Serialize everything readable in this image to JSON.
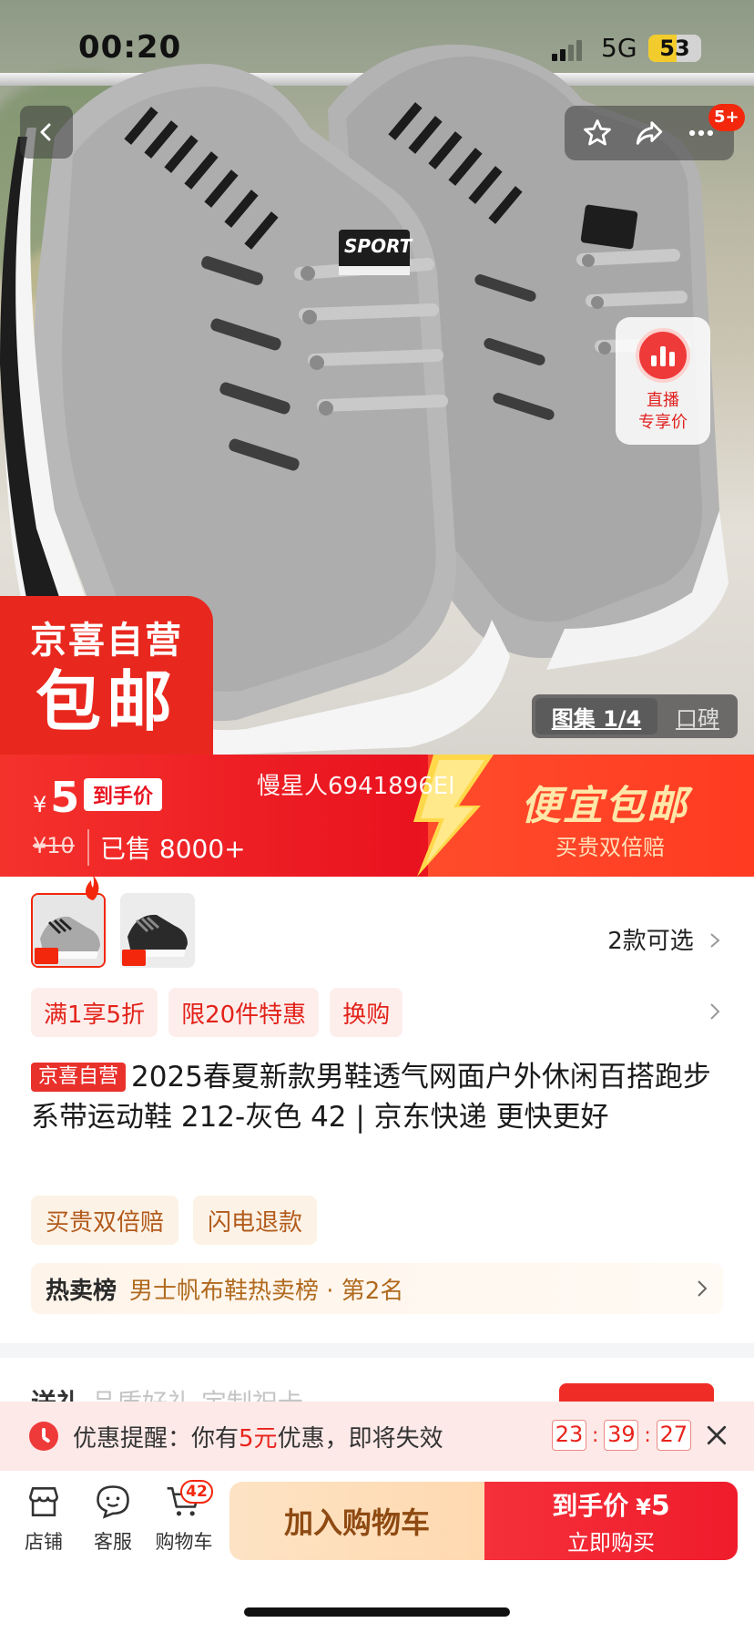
{
  "status_bar": {
    "time": "00:20",
    "network": "5G",
    "battery": "53",
    "battery_level": 0.53
  },
  "hero": {
    "notification_badge": "5+",
    "live_tag": {
      "line1": "直播",
      "line2": "专享价"
    },
    "promo_corner": {
      "line1": "京喜自营",
      "line2": "包邮"
    },
    "gallery": {
      "active_label": "图集 1/4",
      "reviews_label": "口碑"
    },
    "shoe_tongue_text": "SPORT"
  },
  "price_banner": {
    "currency": "¥",
    "price": "5",
    "price_tag": "到手价",
    "old_price": "¥10",
    "sold": "已售 8000+",
    "watermark": "慢星人6941896El",
    "promo_title": "便宜包邮",
    "promo_sub": "买贵双倍赔"
  },
  "variants": {
    "count_label": "2款可选"
  },
  "promo_chips": [
    "满1享5折",
    "限20件特惠",
    "换购"
  ],
  "product": {
    "store_tag": "京喜自营",
    "title": "2025春夏新款男鞋透气网面户外休闲百搭跑步系带运动鞋 212-灰色 42 | 京东快递 更快更好"
  },
  "service_tags": [
    "买贵双倍赔",
    "闪电退款"
  ],
  "rank": {
    "label": "热卖榜",
    "value": "男士帆布鞋热卖榜 · 第2名"
  },
  "peek": {
    "title": "送礼",
    "sub": "品质好礼 定制祝卡"
  },
  "reminder": {
    "prefix": "优惠提醒：你有",
    "amount": "5元",
    "suffix": "优惠，即将失效",
    "hh": "23",
    "mm": "39",
    "ss": "27"
  },
  "bottom_bar": {
    "store": "店铺",
    "service": "客服",
    "cart": "购物车",
    "cart_count": "42",
    "add_cart": "加入购物车",
    "buy_line1": "到手价",
    "buy_currency": "¥",
    "buy_price": "5",
    "buy_line2": "立即购买"
  },
  "colors": {
    "accent": "#f2270c",
    "price_red": "#e9121f",
    "gold": "#ffe7a8"
  }
}
